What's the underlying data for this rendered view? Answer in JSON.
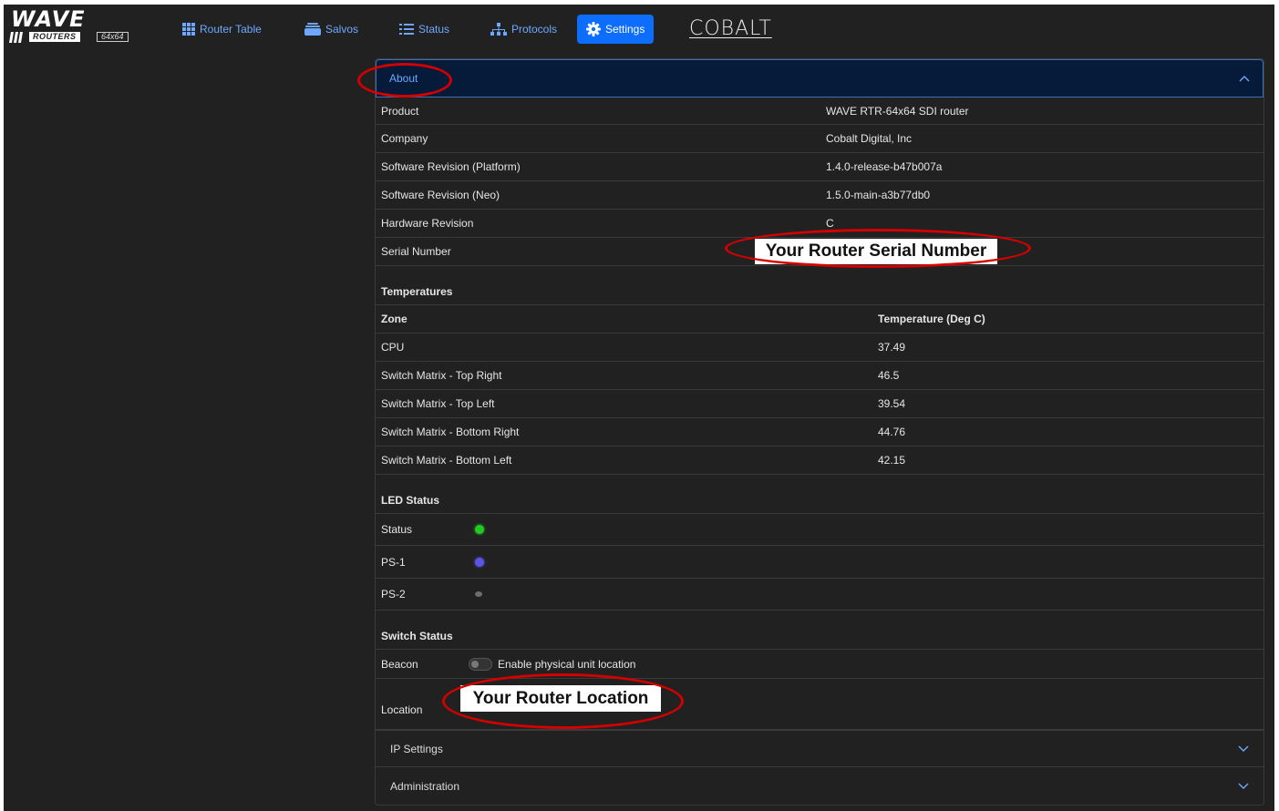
{
  "nav": {
    "logo_wave": "WAVE",
    "logo_routers": "ROUTERS",
    "logo_model": "64x64",
    "items": [
      {
        "label": "Router Table",
        "icon": "grid-icon"
      },
      {
        "label": "Salvos",
        "icon": "stack-icon"
      },
      {
        "label": "Status",
        "icon": "list-icon"
      },
      {
        "label": "Protocols",
        "icon": "network-icon"
      },
      {
        "label": "Settings",
        "icon": "gear-icon",
        "active": true
      }
    ],
    "brand": "COBALT"
  },
  "about": {
    "title": "About",
    "info": [
      {
        "label": "Product",
        "value": "WAVE RTR-64x64 SDI router"
      },
      {
        "label": "Company",
        "value": "Cobalt Digital, Inc"
      },
      {
        "label": "Software Revision (Platform)",
        "value": "1.4.0-release-b47b007a"
      },
      {
        "label": "Software Revision (Neo)",
        "value": "1.5.0-main-a3b77db0"
      },
      {
        "label": "Hardware Revision",
        "value": "C"
      },
      {
        "label": "Serial Number",
        "value": "Your Router Serial Number"
      }
    ],
    "temperatures": {
      "title": "Temperatures",
      "col_zone": "Zone",
      "col_temp": "Temperature (Deg C)",
      "rows": [
        {
          "zone": "CPU",
          "temp": "37.49"
        },
        {
          "zone": "Switch Matrix - Top Right",
          "temp": "46.5"
        },
        {
          "zone": "Switch Matrix - Top Left",
          "temp": "39.54"
        },
        {
          "zone": "Switch Matrix - Bottom Right",
          "temp": "44.76"
        },
        {
          "zone": "Switch Matrix - Bottom Left",
          "temp": "42.15"
        }
      ]
    },
    "led_status": {
      "title": "LED Status",
      "leds": [
        {
          "label": "Status",
          "color": "#22c922"
        },
        {
          "label": "PS-1",
          "color": "#5b55e6"
        },
        {
          "label": "PS-2",
          "color": "#6e6e6e"
        }
      ]
    },
    "switch_status": {
      "title": "Switch Status",
      "beacon_label": "Beacon",
      "beacon_toggle_label": "Enable physical unit location",
      "location_label": "Location",
      "location_value": "Your Router Location"
    }
  },
  "sections": [
    {
      "label": "IP Settings"
    },
    {
      "label": "Administration"
    }
  ],
  "colors": {
    "background": "#212121",
    "accent": "#0d6efd",
    "link": "#6ea8fe",
    "annotation": "#d40000"
  }
}
